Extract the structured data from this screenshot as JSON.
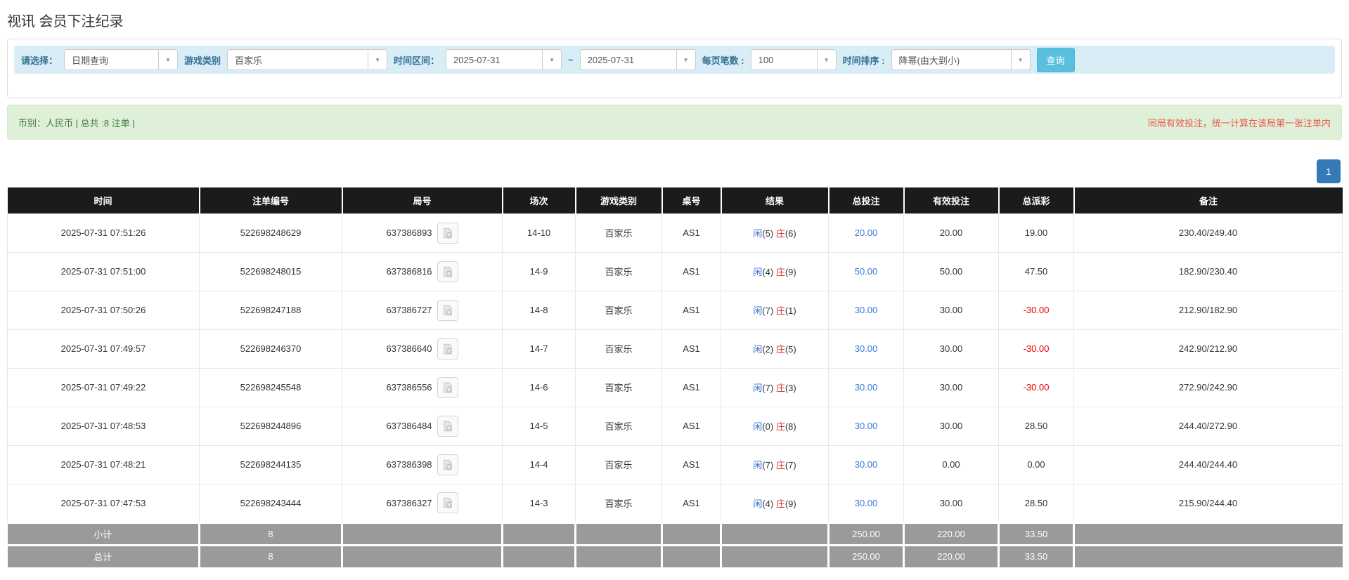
{
  "page": {
    "title": "视讯 会员下注纪录"
  },
  "icons": {
    "dropdown_arrow": "▼",
    "video_replay": "film-reel"
  },
  "filters": {
    "select_label": "请选择：",
    "select_value": "日期查询",
    "game_label": "游戏类别",
    "game_value": "百家乐",
    "range_label": "时间区间：",
    "date_from": "2025-07-31",
    "tilde": "~",
    "date_to": "2025-07-31",
    "per_page_label": "每页笔数 :",
    "per_page_value": "100",
    "sort_label": "时间排序 :",
    "sort_value": "降幂(由大到小)",
    "search_button": "查询"
  },
  "summary": {
    "left": "币别：人民币 | 总共 :8 注单 |",
    "right": "同局有效投注，统一计算在该局第一张注单内"
  },
  "pagination": {
    "current": "1"
  },
  "table": {
    "headers": [
      "时间",
      "注单编号",
      "局号",
      "场次",
      "游戏类别",
      "桌号",
      "结果",
      "总投注",
      "有效投注",
      "总派彩",
      "备注"
    ],
    "rows": [
      {
        "time": "2025-07-31 07:51:26",
        "bet_id": "522698248629",
        "round_id": "637386893",
        "session": "14-10",
        "game": "百家乐",
        "table_no": "AS1",
        "result_player": "闲",
        "result_player_n": "(5)",
        "result_banker": "庄",
        "result_banker_n": "(6)",
        "total_bet": "20.00",
        "valid_bet": "20.00",
        "payout": "19.00",
        "note": "230.40/249.40"
      },
      {
        "time": "2025-07-31 07:51:00",
        "bet_id": "522698248015",
        "round_id": "637386816",
        "session": "14-9",
        "game": "百家乐",
        "table_no": "AS1",
        "result_player": "闲",
        "result_player_n": "(4)",
        "result_banker": "庄",
        "result_banker_n": "(9)",
        "total_bet": "50.00",
        "valid_bet": "50.00",
        "payout": "47.50",
        "note": "182.90/230.40"
      },
      {
        "time": "2025-07-31 07:50:26",
        "bet_id": "522698247188",
        "round_id": "637386727",
        "session": "14-8",
        "game": "百家乐",
        "table_no": "AS1",
        "result_player": "闲",
        "result_player_n": "(7)",
        "result_banker": "庄",
        "result_banker_n": "(1)",
        "total_bet": "30.00",
        "valid_bet": "30.00",
        "payout": "-30.00",
        "note": "212.90/182.90"
      },
      {
        "time": "2025-07-31 07:49:57",
        "bet_id": "522698246370",
        "round_id": "637386640",
        "session": "14-7",
        "game": "百家乐",
        "table_no": "AS1",
        "result_player": "闲",
        "result_player_n": "(2)",
        "result_banker": "庄",
        "result_banker_n": "(5)",
        "total_bet": "30.00",
        "valid_bet": "30.00",
        "payout": "-30.00",
        "note": "242.90/212.90"
      },
      {
        "time": "2025-07-31 07:49:22",
        "bet_id": "522698245548",
        "round_id": "637386556",
        "session": "14-6",
        "game": "百家乐",
        "table_no": "AS1",
        "result_player": "闲",
        "result_player_n": "(7)",
        "result_banker": "庄",
        "result_banker_n": "(3)",
        "total_bet": "30.00",
        "valid_bet": "30.00",
        "payout": "-30.00",
        "note": "272.90/242.90"
      },
      {
        "time": "2025-07-31 07:48:53",
        "bet_id": "522698244896",
        "round_id": "637386484",
        "session": "14-5",
        "game": "百家乐",
        "table_no": "AS1",
        "result_player": "闲",
        "result_player_n": "(0)",
        "result_banker": "庄",
        "result_banker_n": "(8)",
        "total_bet": "30.00",
        "valid_bet": "30.00",
        "payout": "28.50",
        "note": "244.40/272.90"
      },
      {
        "time": "2025-07-31 07:48:21",
        "bet_id": "522698244135",
        "round_id": "637386398",
        "session": "14-4",
        "game": "百家乐",
        "table_no": "AS1",
        "result_player": "闲",
        "result_player_n": "(7)",
        "result_banker": "庄",
        "result_banker_n": "(7)",
        "total_bet": "30.00",
        "valid_bet": "0.00",
        "payout": "0.00",
        "note": "244.40/244.40"
      },
      {
        "time": "2025-07-31 07:47:53",
        "bet_id": "522698243444",
        "round_id": "637386327",
        "session": "14-3",
        "game": "百家乐",
        "table_no": "AS1",
        "result_player": "闲",
        "result_player_n": "(4)",
        "result_banker": "庄",
        "result_banker_n": "(9)",
        "total_bet": "30.00",
        "valid_bet": "30.00",
        "payout": "28.50",
        "note": "215.90/244.40"
      }
    ],
    "subtotal": {
      "label": "小计",
      "count": "8",
      "total_bet": "250.00",
      "valid_bet": "220.00",
      "payout": "33.50"
    },
    "total": {
      "label": "总计",
      "count": "8",
      "total_bet": "250.00",
      "valid_bet": "220.00",
      "payout": "33.50"
    }
  },
  "colors": {
    "accent_blue": "#5bc0de",
    "pagination_blue": "#337ab7",
    "bet_link_blue": "#3a7bd5",
    "player_blue": "#3366cc",
    "banker_red": "#d43b3b",
    "negative_red": "#e60000",
    "notice_red": "#eb5848",
    "filter_bg": "#d9edf7",
    "filter_label": "#31708f",
    "summary_bg": "#dff0d8",
    "summary_text": "#3c763d",
    "header_bg": "#1b1b1b",
    "footer_bg": "#9a9a9a"
  }
}
